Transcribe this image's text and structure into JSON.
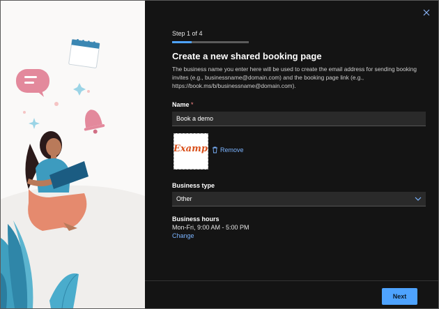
{
  "dialog": {
    "step_text": "Step 1 of 4",
    "progress_fraction": 0.25,
    "title": "Create a new shared booking page",
    "description": "The business name you enter here will be used to create the email address for sending booking invites (e.g., businessname@domain.com) and the booking page link (e.g., https://book.ms/b/businessname@domain.com).",
    "name_label": "Name",
    "required_marker": "*",
    "name_value": "Book a demo",
    "logo_text": "Example",
    "remove_label": "Remove",
    "business_type_label": "Business type",
    "business_type_value": "Other",
    "business_hours_label": "Business hours",
    "business_hours_value": "Mon-Fri, 9:00 AM - 5:00 PM",
    "change_label": "Change",
    "next_label": "Next",
    "close_icon": "close-icon"
  },
  "colors": {
    "accent": "#4ea3ff",
    "link": "#7bb4ff",
    "background": "#141414",
    "illustration_bg": "#faf9f8"
  }
}
